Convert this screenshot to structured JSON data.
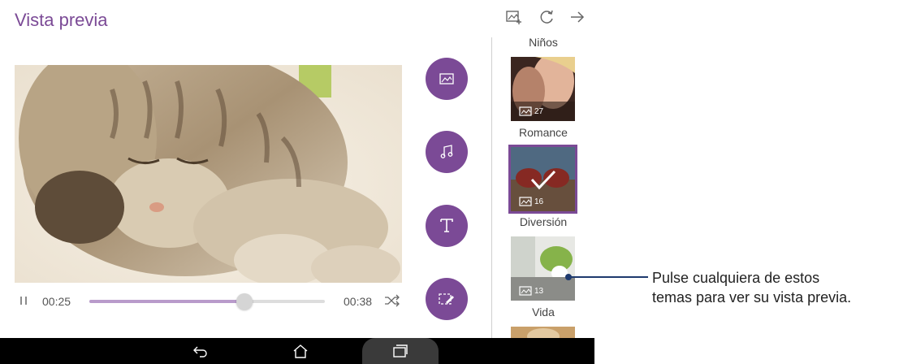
{
  "header": {
    "title": "Vista previa"
  },
  "toolbar": {
    "icons": [
      "add-image-icon",
      "refresh-icon",
      "forward-arrow-icon"
    ]
  },
  "player": {
    "elapsed": "00:25",
    "total": "00:38",
    "progress": 0.66
  },
  "side_buttons": [
    "image-icon",
    "music-icon",
    "text-icon",
    "edit-effects-icon"
  ],
  "themes": [
    {
      "label": "Niños"
    },
    {
      "label": "Romance",
      "count": "27"
    },
    {
      "label": "Diversión",
      "count": "16",
      "selected": true
    },
    {
      "label": "Vida",
      "count": "13"
    }
  ],
  "callout": {
    "line1": "Pulse cualquiera de estos",
    "line2": "temas para ver su vista previa."
  },
  "navbar": {
    "icons": [
      "back-icon",
      "home-icon",
      "recent-apps-icon"
    ]
  },
  "colors": {
    "accent": "#7b4a96",
    "callout_line": "#1e3a6e"
  }
}
